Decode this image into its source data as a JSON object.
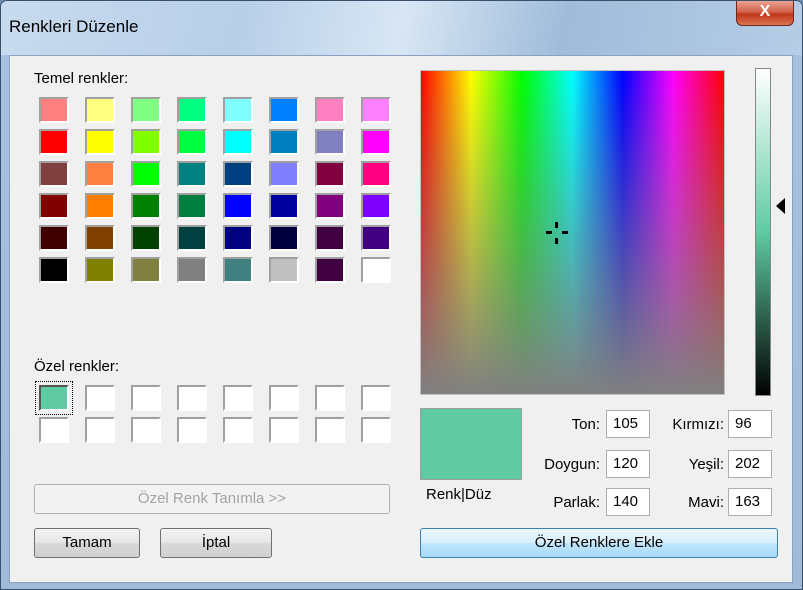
{
  "window": {
    "title": "Renkleri Düzenle",
    "close_label": "X"
  },
  "basic_colors": {
    "label": "Temel renkler:",
    "swatches": [
      "#ff8080",
      "#ffff80",
      "#80ff80",
      "#00ff80",
      "#80ffff",
      "#0080ff",
      "#ff80c0",
      "#ff80ff",
      "#ff0000",
      "#ffff00",
      "#80ff00",
      "#00ff40",
      "#00ffff",
      "#0080c0",
      "#8080c0",
      "#ff00ff",
      "#804040",
      "#ff8040",
      "#00ff00",
      "#008080",
      "#004080",
      "#8080ff",
      "#800040",
      "#ff0080",
      "#800000",
      "#ff8000",
      "#008000",
      "#008040",
      "#0000ff",
      "#0000a0",
      "#800080",
      "#8000ff",
      "#400000",
      "#804000",
      "#004000",
      "#004040",
      "#000080",
      "#000040",
      "#400040",
      "#400080",
      "#000000",
      "#808000",
      "#808040",
      "#808080",
      "#408080",
      "#c0c0c0",
      "#400040",
      "#ffffff"
    ]
  },
  "custom_colors": {
    "label": "Özel renkler:",
    "swatches": [
      "#60caa3",
      "#ffffff",
      "#ffffff",
      "#ffffff",
      "#ffffff",
      "#ffffff",
      "#ffffff",
      "#ffffff",
      "#ffffff",
      "#ffffff",
      "#ffffff",
      "#ffffff",
      "#ffffff",
      "#ffffff",
      "#ffffff",
      "#ffffff"
    ],
    "selected_index": 0
  },
  "buttons": {
    "define_custom": "Özel Renk Tanımla >>",
    "ok": "Tamam",
    "cancel": "İptal",
    "add_custom": "Özel Renklere Ekle"
  },
  "preview": {
    "label": "Renk|Düz",
    "color": "#60caa3"
  },
  "fields": {
    "hue": {
      "label": "Ton:",
      "value": "105"
    },
    "sat": {
      "label": "Doygun:",
      "value": "120"
    },
    "lum": {
      "label": "Parlak:",
      "value": "140"
    },
    "red": {
      "label": "Kırmızı:",
      "value": "96"
    },
    "green": {
      "label": "Yeşil:",
      "value": "202"
    },
    "blue": {
      "label": "Mavi:",
      "value": "163"
    }
  }
}
